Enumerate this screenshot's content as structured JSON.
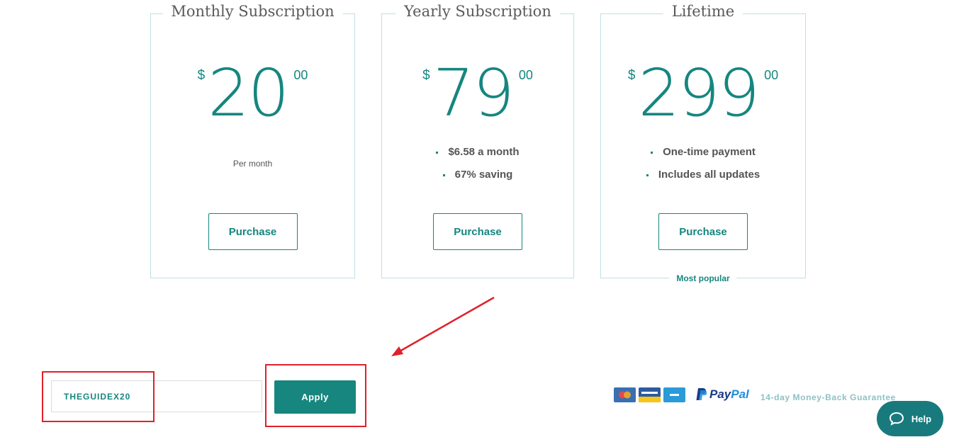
{
  "plans": [
    {
      "title": "Monthly Subscription",
      "currency": "$",
      "amount": "20",
      "cents": "00",
      "description": "Per month",
      "button_label": "Purchase"
    },
    {
      "title": "Yearly Subscription",
      "currency": "$",
      "amount": "79",
      "cents": "00",
      "features": [
        "$6.58 a month",
        "67% saving"
      ],
      "button_label": "Purchase"
    },
    {
      "title": "Lifetime",
      "currency": "$",
      "amount": "299",
      "cents": "00",
      "features": [
        "One-time payment",
        "Includes all updates"
      ],
      "button_label": "Purchase",
      "badge": "Most popular"
    }
  ],
  "coupon": {
    "value": "THEGUIDEX20",
    "apply_label": "Apply"
  },
  "payment": {
    "card_icons": [
      "mastercard-icon",
      "card-icon",
      "card-icon"
    ],
    "paypal_label_a": "Pay",
    "paypal_label_b": "Pal",
    "guarantee": "14-day Money-Back Guarantee"
  },
  "help": {
    "label": "Help"
  },
  "colors": {
    "accent": "#16867f",
    "border": "#bfe0e4",
    "highlight": "#e0202a",
    "help": "#197a7e"
  }
}
